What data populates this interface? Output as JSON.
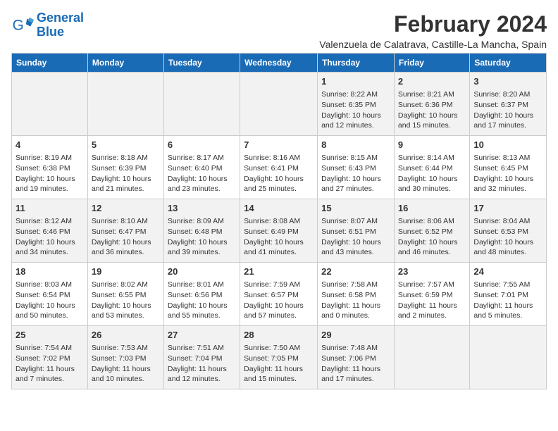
{
  "app": {
    "name": "GeneralBlue",
    "logo_icon": "🔵"
  },
  "header": {
    "month_year": "February 2024",
    "location": "Valenzuela de Calatrava, Castille-La Mancha, Spain"
  },
  "weekdays": [
    "Sunday",
    "Monday",
    "Tuesday",
    "Wednesday",
    "Thursday",
    "Friday",
    "Saturday"
  ],
  "weeks": [
    [
      {
        "day": "",
        "info": ""
      },
      {
        "day": "",
        "info": ""
      },
      {
        "day": "",
        "info": ""
      },
      {
        "day": "",
        "info": ""
      },
      {
        "day": "1",
        "info": "Sunrise: 8:22 AM\nSunset: 6:35 PM\nDaylight: 10 hours\nand 12 minutes."
      },
      {
        "day": "2",
        "info": "Sunrise: 8:21 AM\nSunset: 6:36 PM\nDaylight: 10 hours\nand 15 minutes."
      },
      {
        "day": "3",
        "info": "Sunrise: 8:20 AM\nSunset: 6:37 PM\nDaylight: 10 hours\nand 17 minutes."
      }
    ],
    [
      {
        "day": "4",
        "info": "Sunrise: 8:19 AM\nSunset: 6:38 PM\nDaylight: 10 hours\nand 19 minutes."
      },
      {
        "day": "5",
        "info": "Sunrise: 8:18 AM\nSunset: 6:39 PM\nDaylight: 10 hours\nand 21 minutes."
      },
      {
        "day": "6",
        "info": "Sunrise: 8:17 AM\nSunset: 6:40 PM\nDaylight: 10 hours\nand 23 minutes."
      },
      {
        "day": "7",
        "info": "Sunrise: 8:16 AM\nSunset: 6:41 PM\nDaylight: 10 hours\nand 25 minutes."
      },
      {
        "day": "8",
        "info": "Sunrise: 8:15 AM\nSunset: 6:43 PM\nDaylight: 10 hours\nand 27 minutes."
      },
      {
        "day": "9",
        "info": "Sunrise: 8:14 AM\nSunset: 6:44 PM\nDaylight: 10 hours\nand 30 minutes."
      },
      {
        "day": "10",
        "info": "Sunrise: 8:13 AM\nSunset: 6:45 PM\nDaylight: 10 hours\nand 32 minutes."
      }
    ],
    [
      {
        "day": "11",
        "info": "Sunrise: 8:12 AM\nSunset: 6:46 PM\nDaylight: 10 hours\nand 34 minutes."
      },
      {
        "day": "12",
        "info": "Sunrise: 8:10 AM\nSunset: 6:47 PM\nDaylight: 10 hours\nand 36 minutes."
      },
      {
        "day": "13",
        "info": "Sunrise: 8:09 AM\nSunset: 6:48 PM\nDaylight: 10 hours\nand 39 minutes."
      },
      {
        "day": "14",
        "info": "Sunrise: 8:08 AM\nSunset: 6:49 PM\nDaylight: 10 hours\nand 41 minutes."
      },
      {
        "day": "15",
        "info": "Sunrise: 8:07 AM\nSunset: 6:51 PM\nDaylight: 10 hours\nand 43 minutes."
      },
      {
        "day": "16",
        "info": "Sunrise: 8:06 AM\nSunset: 6:52 PM\nDaylight: 10 hours\nand 46 minutes."
      },
      {
        "day": "17",
        "info": "Sunrise: 8:04 AM\nSunset: 6:53 PM\nDaylight: 10 hours\nand 48 minutes."
      }
    ],
    [
      {
        "day": "18",
        "info": "Sunrise: 8:03 AM\nSunset: 6:54 PM\nDaylight: 10 hours\nand 50 minutes."
      },
      {
        "day": "19",
        "info": "Sunrise: 8:02 AM\nSunset: 6:55 PM\nDaylight: 10 hours\nand 53 minutes."
      },
      {
        "day": "20",
        "info": "Sunrise: 8:01 AM\nSunset: 6:56 PM\nDaylight: 10 hours\nand 55 minutes."
      },
      {
        "day": "21",
        "info": "Sunrise: 7:59 AM\nSunset: 6:57 PM\nDaylight: 10 hours\nand 57 minutes."
      },
      {
        "day": "22",
        "info": "Sunrise: 7:58 AM\nSunset: 6:58 PM\nDaylight: 11 hours\nand 0 minutes."
      },
      {
        "day": "23",
        "info": "Sunrise: 7:57 AM\nSunset: 6:59 PM\nDaylight: 11 hours\nand 2 minutes."
      },
      {
        "day": "24",
        "info": "Sunrise: 7:55 AM\nSunset: 7:01 PM\nDaylight: 11 hours\nand 5 minutes."
      }
    ],
    [
      {
        "day": "25",
        "info": "Sunrise: 7:54 AM\nSunset: 7:02 PM\nDaylight: 11 hours\nand 7 minutes."
      },
      {
        "day": "26",
        "info": "Sunrise: 7:53 AM\nSunset: 7:03 PM\nDaylight: 11 hours\nand 10 minutes."
      },
      {
        "day": "27",
        "info": "Sunrise: 7:51 AM\nSunset: 7:04 PM\nDaylight: 11 hours\nand 12 minutes."
      },
      {
        "day": "28",
        "info": "Sunrise: 7:50 AM\nSunset: 7:05 PM\nDaylight: 11 hours\nand 15 minutes."
      },
      {
        "day": "29",
        "info": "Sunrise: 7:48 AM\nSunset: 7:06 PM\nDaylight: 11 hours\nand 17 minutes."
      },
      {
        "day": "",
        "info": ""
      },
      {
        "day": "",
        "info": ""
      }
    ]
  ]
}
